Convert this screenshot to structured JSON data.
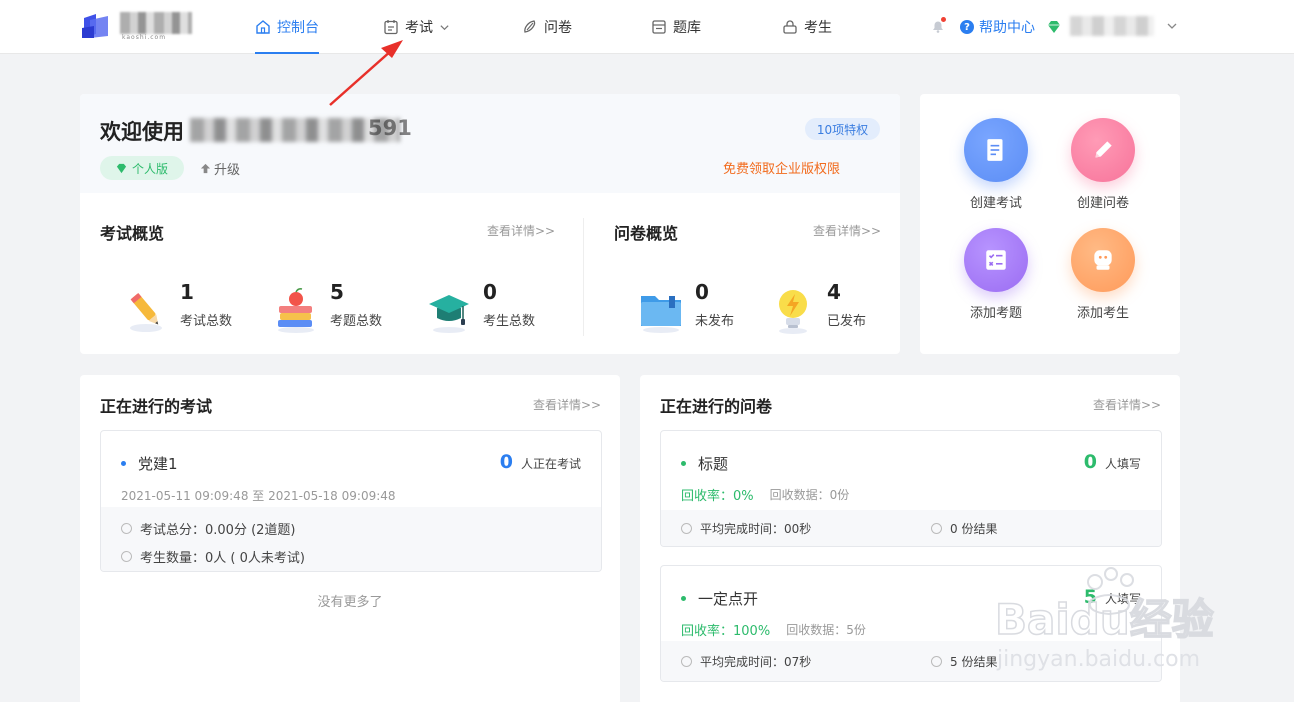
{
  "nav": {
    "logo_subtext": "kaoshi.com",
    "items": [
      {
        "label": "控制台",
        "icon": "home-icon",
        "active": true
      },
      {
        "label": "考试",
        "icon": "exam-icon",
        "dropdown": true
      },
      {
        "label": "问卷",
        "icon": "survey-icon"
      },
      {
        "label": "题库",
        "icon": "question-bank-icon"
      },
      {
        "label": "考生",
        "icon": "candidate-icon"
      }
    ],
    "help_label": "帮助中心"
  },
  "welcome": {
    "title": "欢迎使用",
    "name_tail": "591",
    "plan_label": "个人版",
    "upgrade_label": "升级",
    "perks_label": "10项特权",
    "free_enterprise_label": "免费领取企业版权限"
  },
  "exam_overview": {
    "title": "考试概览",
    "more_label": "查看详情>>",
    "stats": [
      {
        "value": "1",
        "label": "考试总数"
      },
      {
        "value": "5",
        "label": "考题总数"
      },
      {
        "value": "0",
        "label": "考生总数"
      }
    ]
  },
  "survey_overview": {
    "title": "问卷概览",
    "more_label": "查看详情>>",
    "stats": [
      {
        "value": "0",
        "label": "未发布"
      },
      {
        "value": "4",
        "label": "已发布"
      }
    ]
  },
  "quick_actions": [
    {
      "label": "创建考试",
      "color": "#5b8df5"
    },
    {
      "label": "创建问卷",
      "color": "#f7739a"
    },
    {
      "label": "添加考题",
      "color": "#9b6cf2"
    },
    {
      "label": "添加考生",
      "color": "#ff9a5a"
    }
  ],
  "ongoing_exams": {
    "title": "正在进行的考试",
    "more_label": "查看详情>>",
    "items": [
      {
        "name": "党建1",
        "count": "0",
        "count_suffix": "人正在考试",
        "time_range": "2021-05-11 09:09:48 至 2021-05-18 09:09:48",
        "score_text": "考试总分：0.00分 (2道题)",
        "candidates_text": "考生数量：0人 ( 0人未考试)"
      }
    ],
    "no_more": "没有更多了"
  },
  "ongoing_surveys": {
    "title": "正在进行的问卷",
    "more_label": "查看详情>>",
    "items": [
      {
        "name": "标题",
        "count": "0",
        "count_suffix": "人填写",
        "rate_label": "回收率：",
        "rate_value": "0%",
        "data_text": "回收数据：0份",
        "avg_time": "平均完成时间：00秒",
        "results": "0 份结果"
      },
      {
        "name": "一定点开",
        "count": "5",
        "count_suffix": "人填写",
        "rate_label": "回收率：",
        "rate_value": "100%",
        "data_text": "回收数据：5份",
        "avg_time": "平均完成时间：07秒",
        "results": "5 份结果"
      }
    ]
  },
  "watermark": {
    "brand": "Baidu经验",
    "url": "jingyan.baidu.com"
  },
  "colors": {
    "primary": "#2b7ef0",
    "green": "#2dbb6c",
    "orange": "#f26b1d",
    "annotation_arrow": "#e8302a"
  }
}
